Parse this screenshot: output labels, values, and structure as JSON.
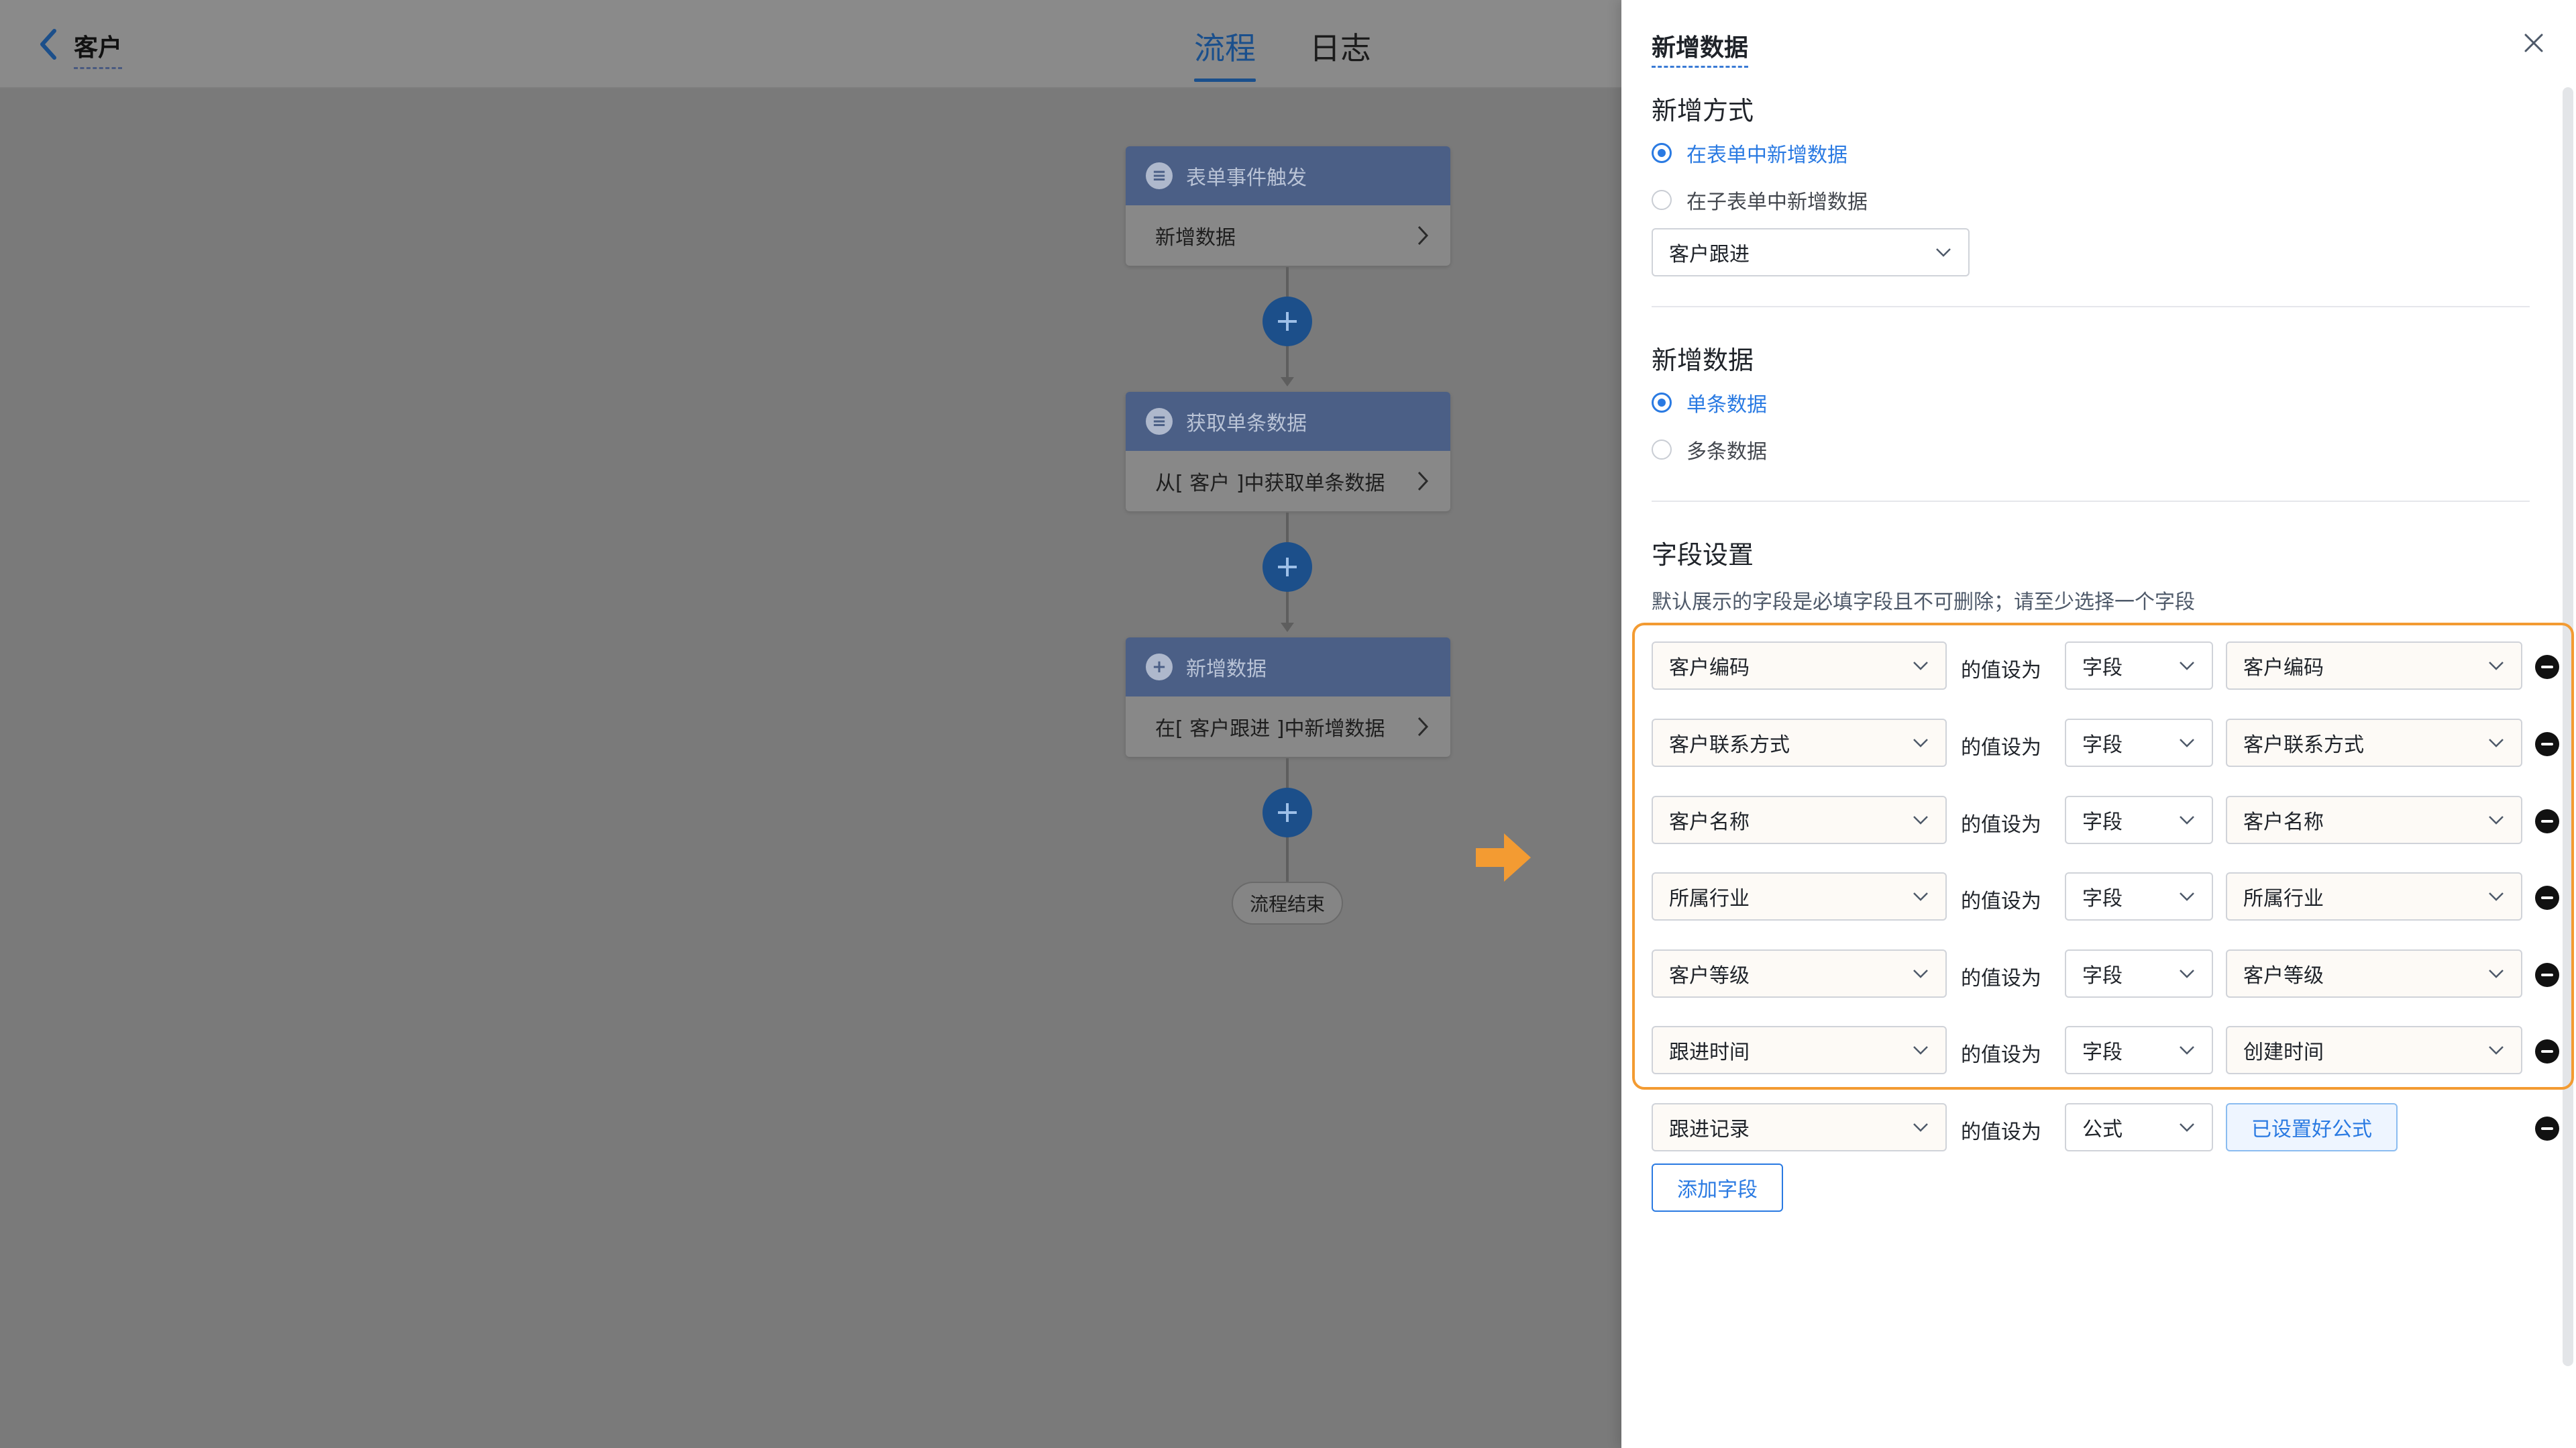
{
  "header": {
    "title": "客户",
    "tabs": [
      {
        "label": "流程",
        "active": true
      },
      {
        "label": "日志",
        "active": false
      }
    ]
  },
  "workflow": {
    "nodes": [
      {
        "head": "表单事件触发",
        "body": "新增数据",
        "icon": "document-icon"
      },
      {
        "head": "获取单条数据",
        "body": "从[ 客户 ]中获取单条数据",
        "icon": "document-icon"
      },
      {
        "head": "新增数据",
        "body": "在[ 客户跟进 ]中新增数据",
        "icon": "plus-circle-icon"
      }
    ],
    "end_label": "流程结束"
  },
  "drawer": {
    "title": "新增数据",
    "mode_section": {
      "title": "新增方式",
      "options": [
        {
          "label": "在表单中新增数据",
          "selected": true
        },
        {
          "label": "在子表单中新增数据",
          "selected": false
        }
      ],
      "form_select": "客户跟进"
    },
    "data_section": {
      "title": "新增数据",
      "options": [
        {
          "label": "单条数据",
          "selected": true
        },
        {
          "label": "多条数据",
          "selected": false
        }
      ]
    },
    "field_section": {
      "title": "字段设置",
      "hint": "默认展示的字段是必填字段且不可删除；请至少选择一个字段",
      "equals_label": "的值设为",
      "rows": [
        {
          "target": "客户编码",
          "type": "字段",
          "source": "客户编码"
        },
        {
          "target": "客户联系方式",
          "type": "字段",
          "source": "客户联系方式"
        },
        {
          "target": "客户名称",
          "type": "字段",
          "source": "客户名称"
        },
        {
          "target": "所属行业",
          "type": "字段",
          "source": "所属行业"
        },
        {
          "target": "客户等级",
          "type": "字段",
          "source": "客户等级"
        },
        {
          "target": "跟进时间",
          "type": "字段",
          "source": "创建时间"
        }
      ],
      "formula_row": {
        "target": "跟进记录",
        "type": "公式",
        "button": "已设置好公式"
      },
      "add_button": "添加字段"
    }
  },
  "colors": {
    "accent": "#2a7ae2",
    "highlight": "#f39b32",
    "node_head": "#4b5f86",
    "plus_button": "#1c4f8a"
  }
}
